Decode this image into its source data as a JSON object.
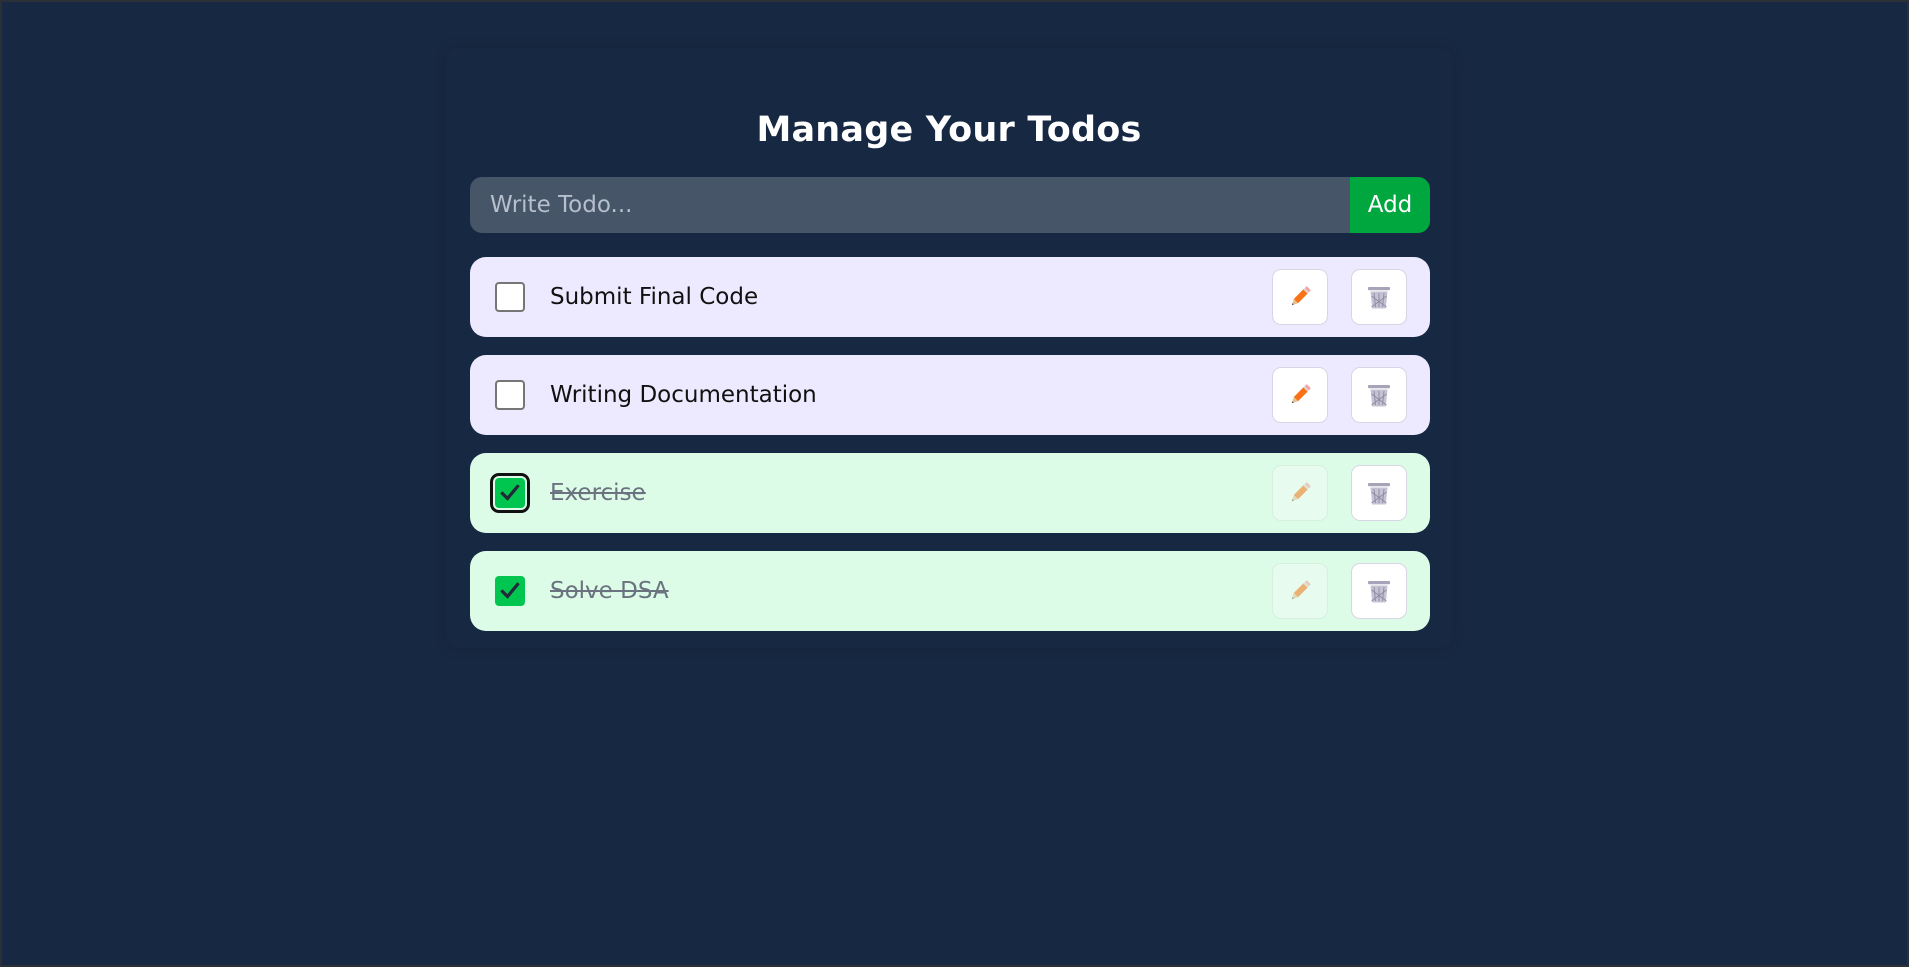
{
  "app": {
    "title": "Manage Your Todos"
  },
  "form": {
    "placeholder": "Write Todo...",
    "value": "",
    "add_label": "Add"
  },
  "todos": [
    {
      "text": "Submit Final Code",
      "completed": false
    },
    {
      "text": "Writing Documentation",
      "completed": false
    },
    {
      "text": "Exercise",
      "completed": true
    },
    {
      "text": "Solve DSA",
      "completed": true
    }
  ],
  "icons": {
    "edit": "pencil-icon",
    "delete": "trash-icon",
    "check": "check-icon"
  },
  "colors": {
    "background": "#172842",
    "input": "#475569",
    "add_button": "#00a63e",
    "pending_item": "#ede9fe",
    "completed_item": "#dcfce7",
    "checkbox_checked": "#00c54f",
    "pencil": "#f97316",
    "trash": "#a6a4b8"
  }
}
